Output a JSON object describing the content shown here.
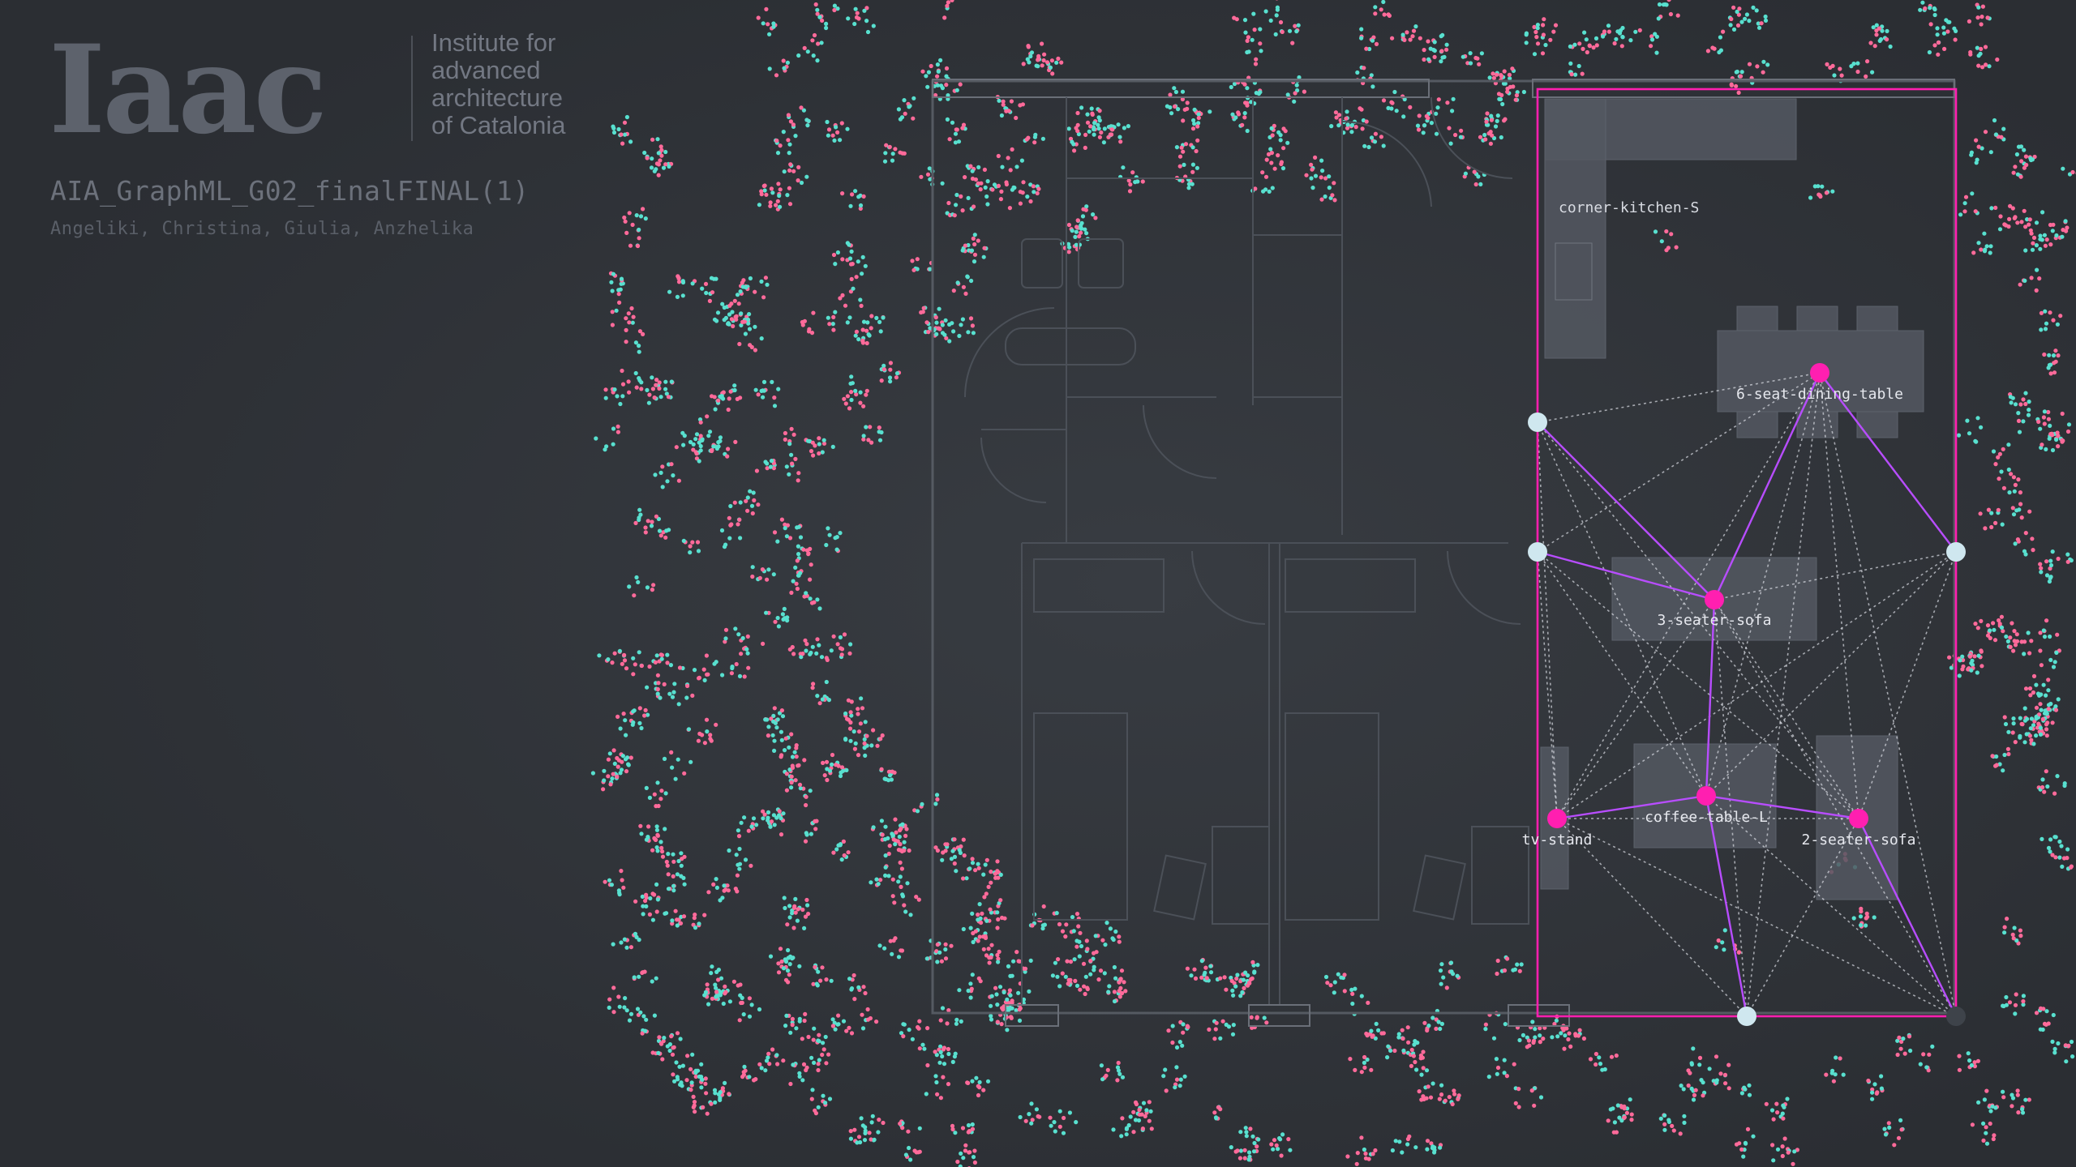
{
  "branding": {
    "logo_text": "Iaac",
    "institute_lines": [
      "Institute for",
      "advanced",
      "architecture",
      "of Catalonia"
    ]
  },
  "project": {
    "title": "AIA_GraphML_G02_finalFINAL(1)",
    "authors": "Angeliki, Christina, Giulia, Anzhelika"
  },
  "graph": {
    "furniture_nodes": [
      {
        "id": "dining",
        "label": "6-seat-dining-table"
      },
      {
        "id": "sofa3",
        "label": "3-seater-sofa"
      },
      {
        "id": "tv",
        "label": "tv-stand"
      },
      {
        "id": "coffee",
        "label": "coffee-table-L"
      },
      {
        "id": "sofa2",
        "label": "2-seater-sofa"
      }
    ],
    "room_labels": [
      {
        "id": "kitchen",
        "label": "corner-kitchen-S"
      }
    ],
    "colors": {
      "background": "#2b2e33",
      "room_outline": "#ff1fb0",
      "furniture_node": "#ff1fb0",
      "wall_node": "#cfe7ef",
      "primary_edge": "#b84dff",
      "secondary_edge": "#d9dce3",
      "dot_teal": "#58e0cf",
      "dot_pink": "#ff6a9a"
    }
  }
}
